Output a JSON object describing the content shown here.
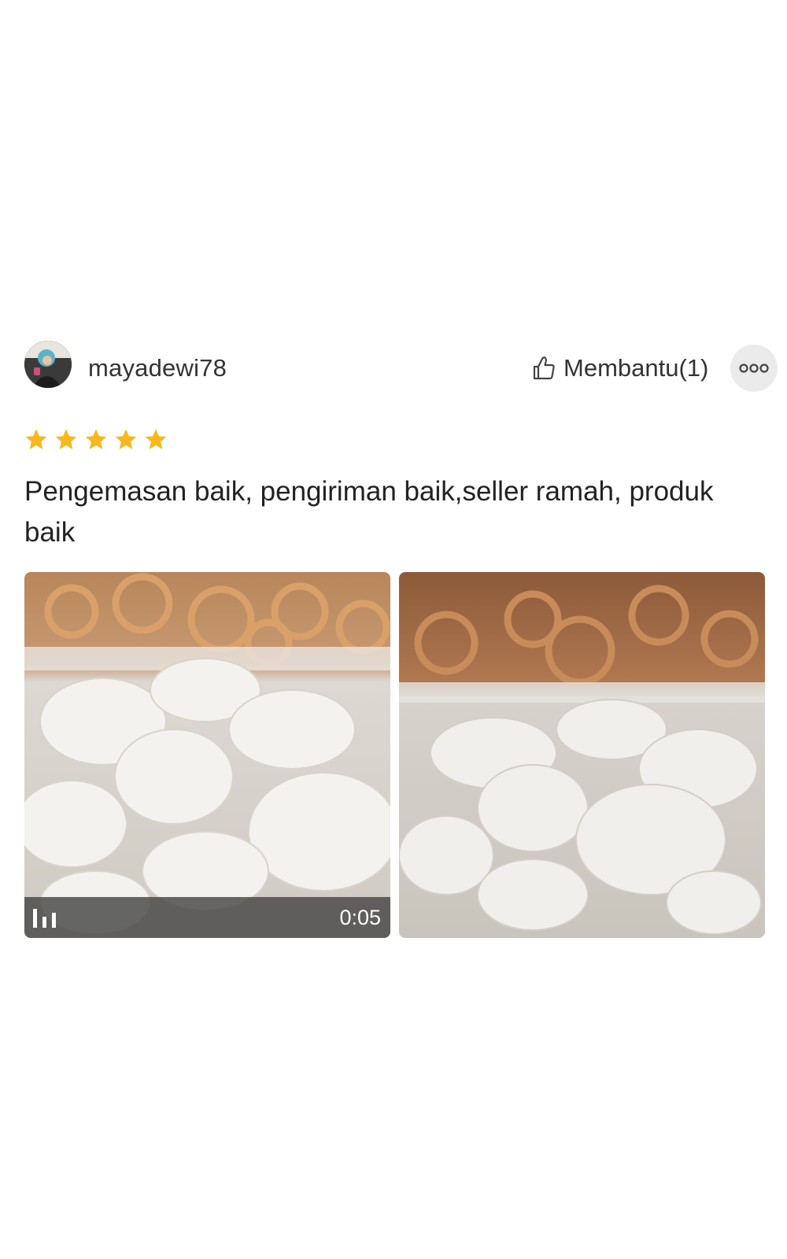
{
  "review": {
    "username": "mayadewi78",
    "helpful_label": "Membantu(1)",
    "rating": 5,
    "rating_max": 5,
    "text": "Pengemasan baik, pengiriman baik,seller ramah, produk baik",
    "media": [
      {
        "type": "video",
        "duration": "0:05",
        "thumbnail": "crackers-in-plastic-bag"
      },
      {
        "type": "image",
        "thumbnail": "crackers-in-plastic-bag"
      }
    ]
  },
  "icons": {
    "helpful": "thumbs-up-icon",
    "more": "more-options-icon",
    "star": "star-icon",
    "video": "video-bars-icon"
  },
  "colors": {
    "star": "#f8b81d",
    "text": "#222222",
    "more_button_bg": "#ebebeb",
    "video_overlay": "#464646"
  }
}
